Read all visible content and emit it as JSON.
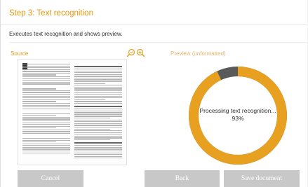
{
  "step_title": "Step 3: Text recognition",
  "description": "Executes text recognition and shows preview.",
  "source_label": "Source",
  "preview_label": "Preview (unformatted)",
  "progress": {
    "status": "Processing text recognition...",
    "percent_text": "93%",
    "fraction": 0.93,
    "track_color": "#5a5a5a",
    "fill_color": "#e8a020"
  },
  "zoom": {
    "out_icon": "zoom-out-icon",
    "in_icon": "zoom-in-icon"
  },
  "buttons": {
    "cancel": "Cancel",
    "back": "Back",
    "save": "Save document"
  },
  "colors": {
    "accent": "#e8960f",
    "button_bg": "#c8c8c8"
  }
}
